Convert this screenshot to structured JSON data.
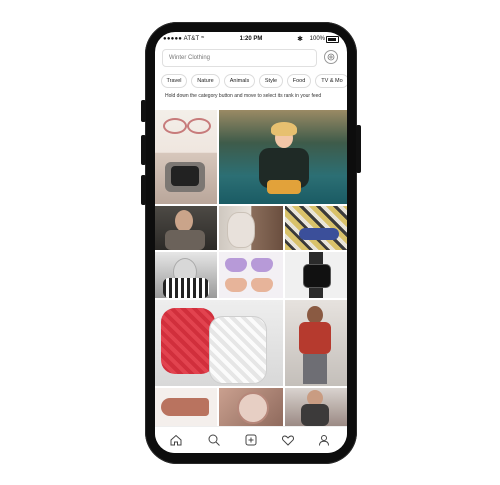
{
  "status": {
    "carrier": "●●●●● AT&T",
    "time": "1:20 PM",
    "battery": "100%"
  },
  "search": {
    "value": "Winter Clothing"
  },
  "categories": [
    "Travel",
    "Nature",
    "Animals",
    "Style",
    "Food",
    "TV & Mo"
  ],
  "hint": "Hold down the category button and move to select its rank in your feed",
  "icons": {
    "filter": "filter-settings-icon",
    "tabs": [
      "home-icon",
      "search-icon",
      "add-post-icon",
      "heart-icon",
      "profile-icon"
    ]
  },
  "colors": {
    "phone_body": "#0d0d0d",
    "screen_bg": "#ffffff",
    "chip_border": "#dcdcdc"
  }
}
